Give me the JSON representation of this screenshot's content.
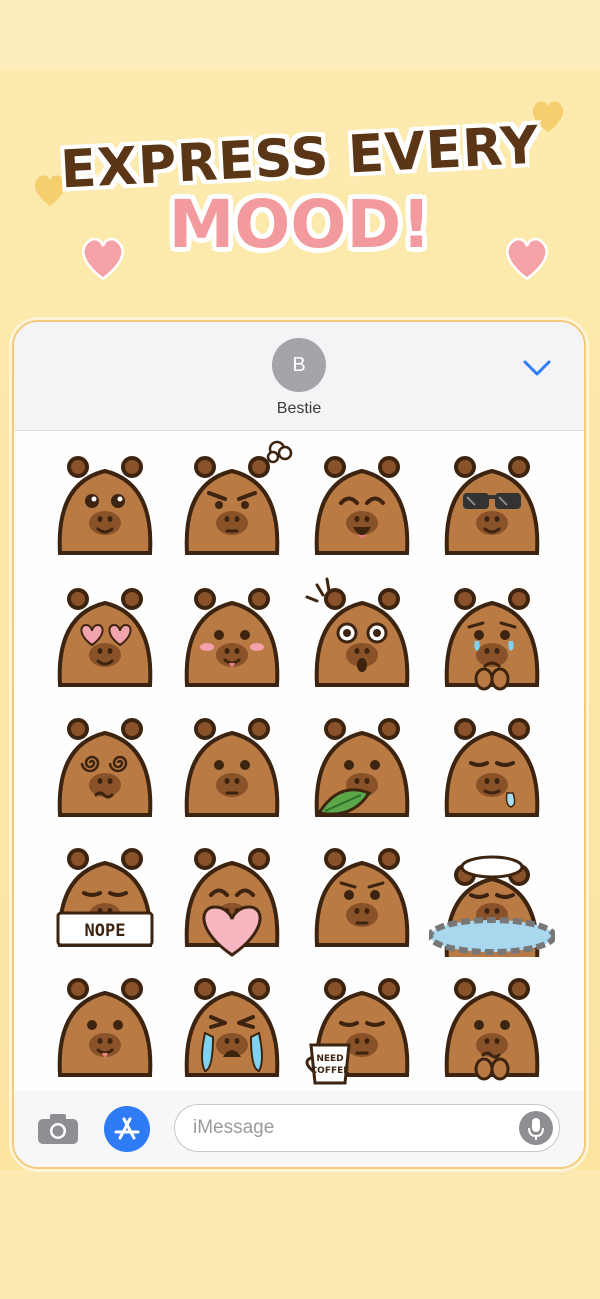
{
  "headline": {
    "line1": "EXPRESS EVERY",
    "line2": "MOOD!"
  },
  "header": {
    "avatar_initial": "B",
    "contact_name": "Bestie"
  },
  "stickers": [
    {
      "name": "happy",
      "eyes": "sparkle",
      "mouth": "smile",
      "extra": ""
    },
    {
      "name": "grumpy",
      "eyes": "angry",
      "mouth": "flat",
      "extra": "puff",
      "label": ""
    },
    {
      "name": "laughing",
      "eyes": "closed-happy",
      "mouth": "open",
      "extra": ""
    },
    {
      "name": "cool",
      "eyes": "sunglasses",
      "mouth": "smile",
      "extra": ""
    },
    {
      "name": "in-love",
      "eyes": "hearts",
      "mouth": "smile",
      "extra": ""
    },
    {
      "name": "shy",
      "eyes": "dots",
      "mouth": "tongue",
      "extra": "blush"
    },
    {
      "name": "shocked",
      "eyes": "wide",
      "mouth": "o",
      "extra": "shock"
    },
    {
      "name": "teary",
      "eyes": "teary",
      "mouth": "frown",
      "extra": "paws"
    },
    {
      "name": "dizzy",
      "eyes": "spiral",
      "mouth": "wobble",
      "extra": ""
    },
    {
      "name": "neutral",
      "eyes": "dots",
      "mouth": "flat",
      "extra": ""
    },
    {
      "name": "munching",
      "eyes": "dots",
      "mouth": "flat",
      "extra": "leaf"
    },
    {
      "name": "sleepy-drool",
      "eyes": "sleepy",
      "mouth": "drool",
      "extra": ""
    },
    {
      "name": "nope",
      "eyes": "sleepy",
      "mouth": "flat",
      "extra": "sign",
      "label": "NOPE"
    },
    {
      "name": "heart-hug",
      "eyes": "closed-happy",
      "mouth": "flat",
      "extra": "heart"
    },
    {
      "name": "worried",
      "eyes": "dots",
      "mouth": "flat",
      "extra": "brows"
    },
    {
      "name": "onsen",
      "eyes": "closed",
      "mouth": "flat",
      "extra": "onsen"
    },
    {
      "name": "cheerful",
      "eyes": "dots",
      "mouth": "tongue",
      "extra": ""
    },
    {
      "name": "crying",
      "eyes": "squint",
      "mouth": "wail",
      "extra": "tears"
    },
    {
      "name": "tired-coffee",
      "eyes": "sleepy",
      "mouth": "flat",
      "extra": "coffee",
      "label": "NEED COFFEE"
    },
    {
      "name": "nervous",
      "eyes": "dots",
      "mouth": "wobble",
      "extra": "paws"
    }
  ],
  "composer": {
    "placeholder": "iMessage"
  },
  "colors": {
    "fur": "#b97a44",
    "fur_dark": "#8a5228",
    "outline": "#3d2410",
    "accent_blue": "#2d7cf6",
    "headline_pink": "#f29a9d"
  }
}
